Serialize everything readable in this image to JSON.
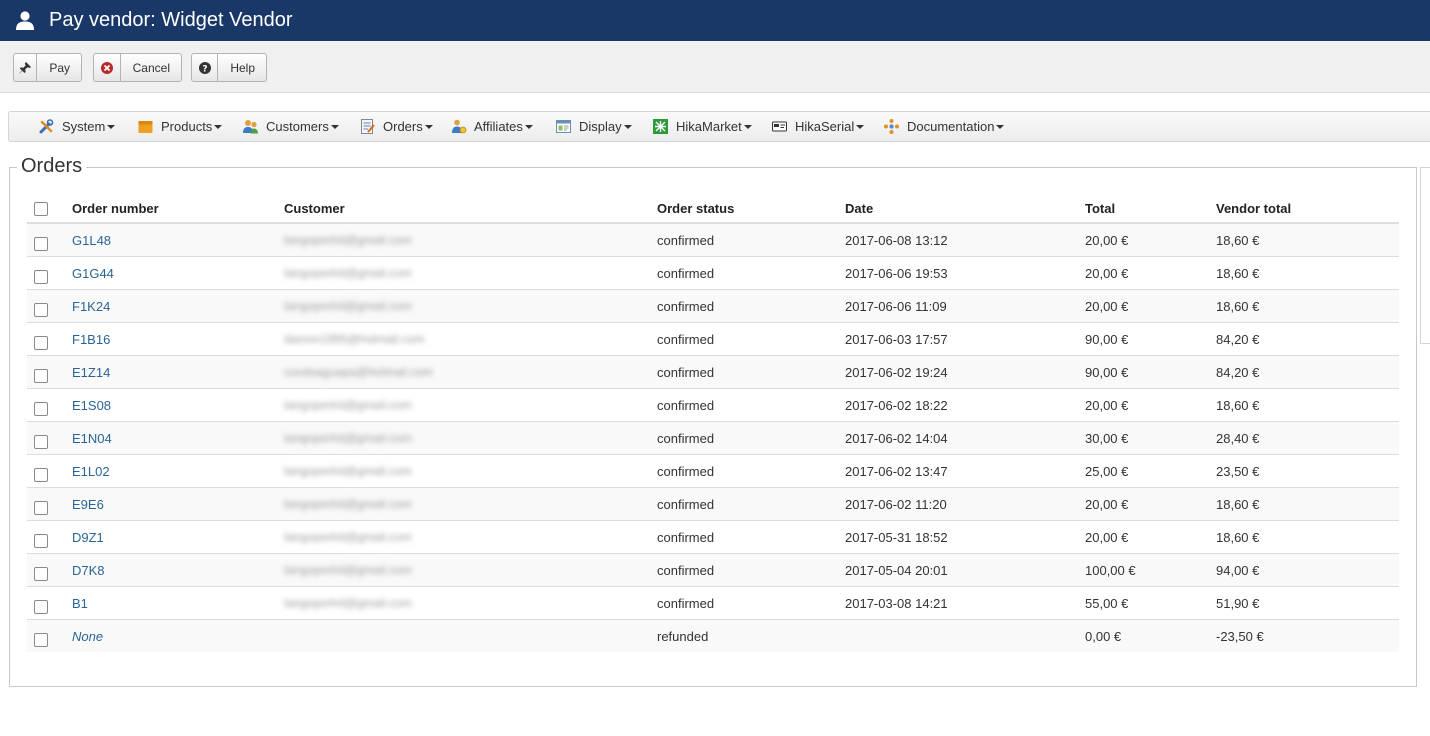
{
  "header": {
    "title": "Pay vendor: Widget Vendor"
  },
  "toolbar": {
    "pay_label": "Pay",
    "cancel_label": "Cancel",
    "help_label": "Help"
  },
  "menu": [
    {
      "label": "System"
    },
    {
      "label": "Products"
    },
    {
      "label": "Customers"
    },
    {
      "label": "Orders"
    },
    {
      "label": "Affiliates"
    },
    {
      "label": "Display"
    },
    {
      "label": "HikaMarket"
    },
    {
      "label": "HikaSerial"
    },
    {
      "label": "Documentation"
    }
  ],
  "orders": {
    "legend": "Orders",
    "columns": {
      "order_number": "Order number",
      "customer": "Customer",
      "order_status": "Order status",
      "date": "Date",
      "total": "Total",
      "vendor_total": "Vendor total"
    },
    "rows": [
      {
        "number": "G1L48",
        "customer": "tangoperlrd@gmail.com",
        "status": "confirmed",
        "date": "2017-06-08 13:12",
        "total": "20,00 €",
        "vendor_total": "18,60 €"
      },
      {
        "number": "G1G44",
        "customer": "tangoperlrd@gmail.com",
        "status": "confirmed",
        "date": "2017-06-06 19:53",
        "total": "20,00 €",
        "vendor_total": "18,60 €"
      },
      {
        "number": "F1K24",
        "customer": "tangoperlrd@gmail.com",
        "status": "confirmed",
        "date": "2017-06-06 11:09",
        "total": "20,00 €",
        "vendor_total": "18,60 €"
      },
      {
        "number": "F1B16",
        "customer": "damon1995@hotmail.com",
        "status": "confirmed",
        "date": "2017-06-03 17:57",
        "total": "90,00 €",
        "vendor_total": "84,20 €"
      },
      {
        "number": "E1Z14",
        "customer": "coralsaguapa@hotmail.com",
        "status": "confirmed",
        "date": "2017-06-02 19:24",
        "total": "90,00 €",
        "vendor_total": "84,20 €"
      },
      {
        "number": "E1S08",
        "customer": "tangoperlrd@gmail.com",
        "status": "confirmed",
        "date": "2017-06-02 18:22",
        "total": "20,00 €",
        "vendor_total": "18,60 €"
      },
      {
        "number": "E1N04",
        "customer": "tangoperlrd@gmail.com",
        "status": "confirmed",
        "date": "2017-06-02 14:04",
        "total": "30,00 €",
        "vendor_total": "28,40 €"
      },
      {
        "number": "E1L02",
        "customer": "tangoperlrd@gmail.com",
        "status": "confirmed",
        "date": "2017-06-02 13:47",
        "total": "25,00 €",
        "vendor_total": "23,50 €"
      },
      {
        "number": "E9E6",
        "customer": "tangoperlrd@gmail.com",
        "status": "confirmed",
        "date": "2017-06-02 11:20",
        "total": "20,00 €",
        "vendor_total": "18,60 €"
      },
      {
        "number": "D9Z1",
        "customer": "tangoperlrd@gmail.com",
        "status": "confirmed",
        "date": "2017-05-31 18:52",
        "total": "20,00 €",
        "vendor_total": "18,60 €"
      },
      {
        "number": "D7K8",
        "customer": "tangoperlrd@gmail.com",
        "status": "confirmed",
        "date": "2017-05-04 20:01",
        "total": "100,00 €",
        "vendor_total": "94,00 €"
      },
      {
        "number": "B1",
        "customer": "tangoperlrd@gmail.com",
        "status": "confirmed",
        "date": "2017-03-08 14:21",
        "total": "55,00 €",
        "vendor_total": "51,90 €"
      },
      {
        "number": "None",
        "customer": "",
        "status": "refunded",
        "date": "",
        "total": "0,00 €",
        "vendor_total": "-23,50 €"
      }
    ]
  }
}
